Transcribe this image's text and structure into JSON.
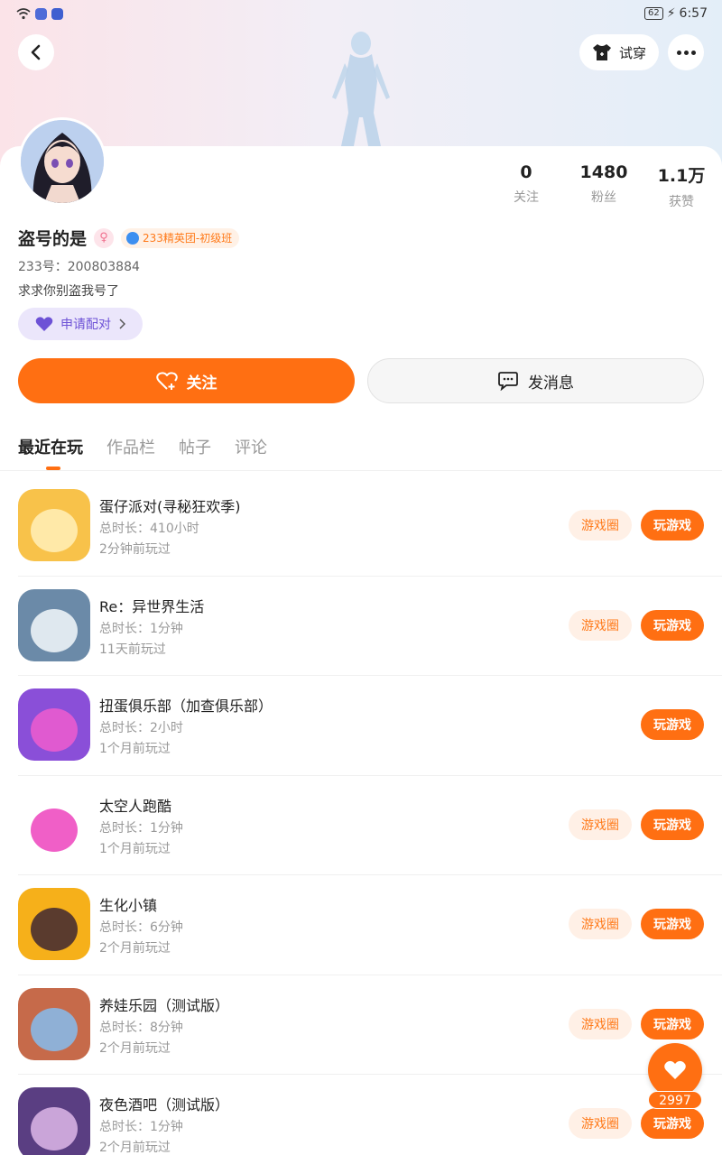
{
  "status_bar": {
    "time": "6:57",
    "battery": "62"
  },
  "header": {
    "tryon_label": "试穿"
  },
  "profile": {
    "name": "盗号的是",
    "gender_symbol": "♀",
    "badge": "233精英团-初级班",
    "uid": "233号：200803884",
    "bio": "求求你别盗我号了",
    "pair_label": "申请配对",
    "stats": [
      {
        "num": "0",
        "label": "关注"
      },
      {
        "num": "1480",
        "label": "粉丝"
      },
      {
        "num": "1.1万",
        "label": "获赞"
      }
    ]
  },
  "actions": {
    "follow": "关注",
    "message": "发消息"
  },
  "tabs": [
    "最近在玩",
    "作品栏",
    "帖子",
    "评论"
  ],
  "game_circle_label": "游戏圈",
  "play_label": "玩游戏",
  "games": [
    {
      "title": "蛋仔派对(寻秘狂欢季)",
      "duration": "总时长：410小时",
      "last": "2分钟前玩过",
      "has_circle": true,
      "icon_colors": [
        "#f8c24a",
        "#ffe9a8"
      ]
    },
    {
      "title": "Re：异世界生活",
      "duration": "总时长：1分钟",
      "last": "11天前玩过",
      "has_circle": true,
      "icon_colors": [
        "#6b8aa8",
        "#dfe8ef"
      ]
    },
    {
      "title": "扭蛋俱乐部（加查俱乐部）",
      "duration": "总时长：2小时",
      "last": "1个月前玩过",
      "has_circle": false,
      "icon_colors": [
        "#8a4fd8",
        "#e05ad0"
      ]
    },
    {
      "title": "太空人跑酷",
      "duration": "总时长：1分钟",
      "last": "1个月前玩过",
      "has_circle": true,
      "icon_colors": [
        "#ffffff",
        "#f05fc7"
      ]
    },
    {
      "title": "生化小镇",
      "duration": "总时长：6分钟",
      "last": "2个月前玩过",
      "has_circle": true,
      "icon_colors": [
        "#f6b01a",
        "#5a3b2e"
      ]
    },
    {
      "title": "养娃乐园（测试版）",
      "duration": "总时长：8分钟",
      "last": "2个月前玩过",
      "has_circle": true,
      "icon_colors": [
        "#c66a4a",
        "#8fb0d6"
      ]
    },
    {
      "title": "夜色酒吧（测试版）",
      "duration": "总时长：1分钟",
      "last": "2个月前玩过",
      "has_circle": true,
      "icon_colors": [
        "#5a3e82",
        "#caa5d9"
      ]
    }
  ],
  "fab": {
    "count": "2997"
  },
  "colors": {
    "accent": "#ff6f12",
    "circle_bg": "#fff0e6",
    "pair_bg": "#ebe6fb"
  }
}
